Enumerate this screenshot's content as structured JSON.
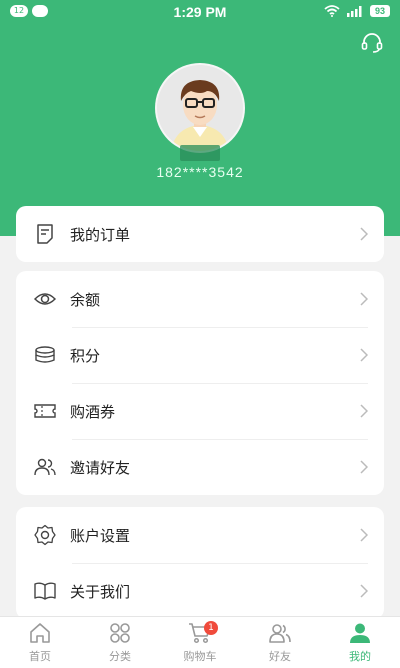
{
  "status_bar": {
    "left_badge": "12",
    "time": "1:29 PM",
    "battery": "93"
  },
  "profile": {
    "phone": "182****3542"
  },
  "menu_cards": [
    {
      "items": [
        {
          "label": "我的订单",
          "icon": "order-icon"
        }
      ]
    },
    {
      "items": [
        {
          "label": "余额",
          "icon": "eye-icon"
        },
        {
          "label": "积分",
          "icon": "coins-icon"
        },
        {
          "label": "购酒券",
          "icon": "ticket-icon"
        },
        {
          "label": "邀请好友",
          "icon": "users-icon"
        }
      ]
    },
    {
      "items": [
        {
          "label": "账户设置",
          "icon": "gear-icon"
        },
        {
          "label": "关于我们",
          "icon": "book-icon"
        }
      ]
    }
  ],
  "tab_bar": {
    "tabs": [
      {
        "label": "首页",
        "icon": "home-icon"
      },
      {
        "label": "分类",
        "icon": "category-icon"
      },
      {
        "label": "购物车",
        "icon": "cart-icon",
        "badge": "1"
      },
      {
        "label": "好友",
        "icon": "friends-icon"
      },
      {
        "label": "我的",
        "icon": "me-icon",
        "active": true
      }
    ]
  },
  "colors": {
    "brand": "#3cb878",
    "badge": "#f04b3c"
  }
}
